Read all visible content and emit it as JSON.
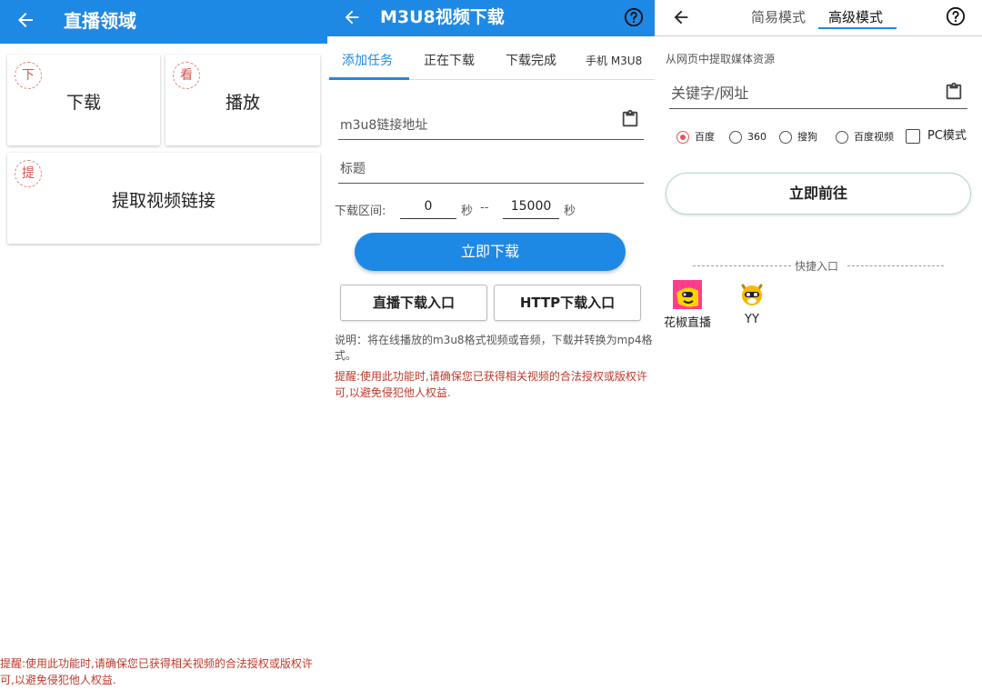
{
  "panel1": {
    "title": "直播领域",
    "tiles": [
      {
        "badge": "下",
        "label": "下载"
      },
      {
        "badge": "看",
        "label": "播放"
      },
      {
        "badge": "提",
        "label": "提取视频链接"
      }
    ],
    "warning_line1": "提醒:使用此功能时,请确保您已获得相关视频的合法授权或版权许",
    "warning_line2": "可,以避免侵犯他人权益."
  },
  "panel2": {
    "title": "M3U8视频下载",
    "tabs": [
      "添加任务",
      "正在下载",
      "下载完成",
      "手机 M3U8"
    ],
    "url_placeholder": "m3u8链接地址",
    "title_placeholder": "标题",
    "range_label": "下载区间:",
    "range_start": "0",
    "range_sec1": "秒",
    "range_dash": "--",
    "range_end": "15000",
    "range_sec2": "秒",
    "download_button": "立即下载",
    "live_entry_button": "直播下载入口",
    "http_entry_button": "HTTP下载入口",
    "note_line1": "说明：将在线播放的m3u8格式视频或音频，下载并转换为mp4格",
    "note_line2": "式。",
    "warning_line1": "提醒:使用此功能时,请确保您已获得相关视频的合法授权或版权许",
    "warning_line2": "可,以避免侵犯他人权益."
  },
  "panel3": {
    "mode_simple": "简易模式",
    "mode_advanced": "高级模式",
    "section_label": "从网页中提取媒体资源",
    "search_placeholder": "关键字/网址",
    "engines": [
      {
        "label": "百度",
        "selected": true
      },
      {
        "label": "360",
        "selected": false
      },
      {
        "label": "搜狗",
        "selected": false
      },
      {
        "label": "百度视频",
        "selected": false
      }
    ],
    "pc_mode_label": "PC模式",
    "pc_mode_checked": false,
    "go_button": "立即前往",
    "quick_entry_label": "快捷入口",
    "shortcuts": [
      {
        "label": "花椒直播",
        "icon": "huajiao-logo-icon"
      },
      {
        "label": "YY",
        "icon": "yy-logo-icon"
      }
    ]
  },
  "colors": {
    "app_blue": "#1e88e5",
    "warning_red": "#c0392b",
    "radio_selected": "#e05a5a"
  }
}
